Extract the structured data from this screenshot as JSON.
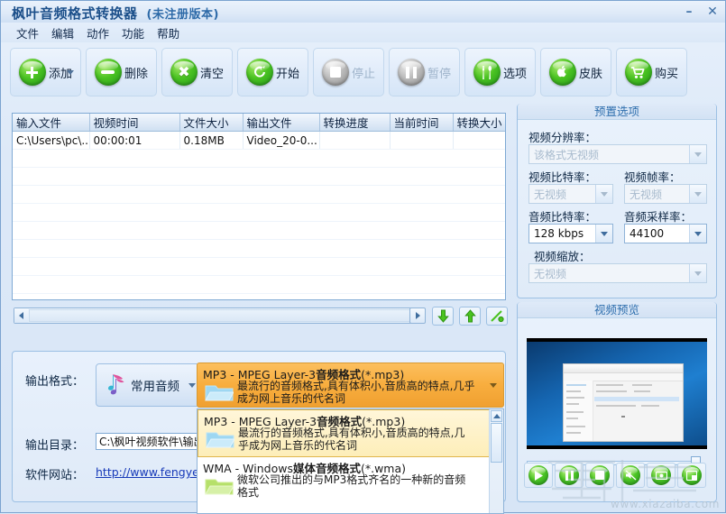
{
  "window": {
    "title": "枫叶音频格式转换器",
    "subtitle": "(未注册版本)",
    "minimize": "–",
    "close": "✕"
  },
  "menubar": {
    "items": [
      {
        "label": "文件"
      },
      {
        "label": "编辑"
      },
      {
        "label": "动作"
      },
      {
        "label": "功能"
      },
      {
        "label": "帮助"
      }
    ]
  },
  "toolbar": {
    "buttons": [
      {
        "label": "添加",
        "icon": "plus-circle-icon",
        "enabled": true,
        "has_caret": true
      },
      {
        "label": "删除",
        "icon": "minus-circle-icon",
        "enabled": true,
        "has_caret": false
      },
      {
        "label": "清空",
        "icon": "clear-x-icon",
        "enabled": true,
        "has_caret": false
      },
      {
        "label": "开始",
        "icon": "start-refresh-icon",
        "enabled": true,
        "has_caret": false
      },
      {
        "label": "停止",
        "icon": "stop-square-icon",
        "enabled": false,
        "has_caret": false
      },
      {
        "label": "暂停",
        "icon": "pause-icon",
        "enabled": false,
        "has_caret": false
      },
      {
        "label": "选项",
        "icon": "tools-icon",
        "enabled": true,
        "has_caret": false
      },
      {
        "label": "皮肤",
        "icon": "apple-skin-icon",
        "enabled": true,
        "has_caret": false
      },
      {
        "label": "购买",
        "icon": "shopping-cart-icon",
        "enabled": true,
        "has_caret": false
      }
    ]
  },
  "filelist": {
    "columns": [
      "输入文件",
      "视频时间",
      "文件大小",
      "输出文件",
      "转换进度",
      "当前时间",
      "转换大小"
    ],
    "rows": [
      {
        "input_file": "C:\\Users\\pc\\...",
        "video_time": "00:00:01",
        "file_size": "0.18MB",
        "output_file": "Video_20-0...",
        "progress": "",
        "current_time": "",
        "converted_size": ""
      }
    ],
    "empty_row_count": 10
  },
  "scrollrow": {
    "left_arrow": "◀",
    "right_arrow": "▶",
    "buttons": [
      {
        "name": "move-down-button",
        "icon": "green-down-arrow-icon"
      },
      {
        "name": "move-up-button",
        "icon": "green-up-arrow-icon"
      },
      {
        "name": "edit-button",
        "icon": "green-pencil-icon"
      }
    ]
  },
  "output_panel": {
    "format_label": "输出格式：",
    "format_value": "常用音频",
    "dir_label": "输出目录：",
    "dir_value": "C:\\枫叶视频软件\\输出",
    "site_label": "软件网站：",
    "site_url": "http://www.fengyesoft.c"
  },
  "format_combo": {
    "title_prefix": "MP3 - MPEG Layer-3",
    "title_bold": "音频格式",
    "title_ext": "(*.mp3)",
    "description": "最流行的音频格式,具有体积小,音质高的特点,几乎成为网上音乐的代名词"
  },
  "format_dropdown": {
    "items": [
      {
        "title_prefix": "MP3 - MPEG Layer-3",
        "title_bold": "音频格式",
        "title_ext": "(*.mp3)",
        "description": "最流行的音频格式,具有体积小,音质高的特点,几乎成为网上音乐的代名词",
        "selected": true,
        "folder_color": "#9ed7f2"
      },
      {
        "title_prefix": "WMA - Windows",
        "title_bold": "媒体音频格式",
        "title_ext": "(*.wma)",
        "description": "微软公司推出的与MP3格式齐名的一种新的音频格式",
        "selected": false,
        "folder_color": "#b6e06a"
      }
    ]
  },
  "preset_options": {
    "title": "预置选项",
    "fields": [
      {
        "label": "视频分辨率：",
        "value": "该格式无视频",
        "disabled": true
      },
      {
        "label": "视频比特率：",
        "value": "无视频",
        "disabled": true
      },
      {
        "label": "视频帧率：",
        "value": "无视频",
        "disabled": true
      },
      {
        "label": "音频比特率：",
        "value": "128 kbps",
        "disabled": false
      },
      {
        "label": "音频采样率：",
        "value": "44100",
        "disabled": false
      },
      {
        "label": "视频缩放：",
        "value": "无视频",
        "disabled": true
      }
    ]
  },
  "video_preview": {
    "title": "视频预览",
    "controls": [
      {
        "name": "preview-play-button",
        "icon": "play-icon"
      },
      {
        "name": "preview-pause-button",
        "icon": "pause-icon"
      },
      {
        "name": "preview-stop-button",
        "icon": "stop-icon"
      },
      {
        "name": "preview-mute-button",
        "icon": "mute-icon"
      },
      {
        "name": "preview-snapshot-button",
        "icon": "snapshot-icon"
      },
      {
        "name": "preview-fullscreen-button",
        "icon": "fullscreen-icon"
      }
    ]
  },
  "watermark": {
    "text": "www.xiazaiba.com"
  },
  "colors": {
    "accent": "#2f6fae",
    "title": "#1b4f8a",
    "highlight_orange": "#f8ae3f",
    "selected_yellow": "#fdeeb9",
    "green": "#4bc322",
    "link": "#1639b8"
  }
}
